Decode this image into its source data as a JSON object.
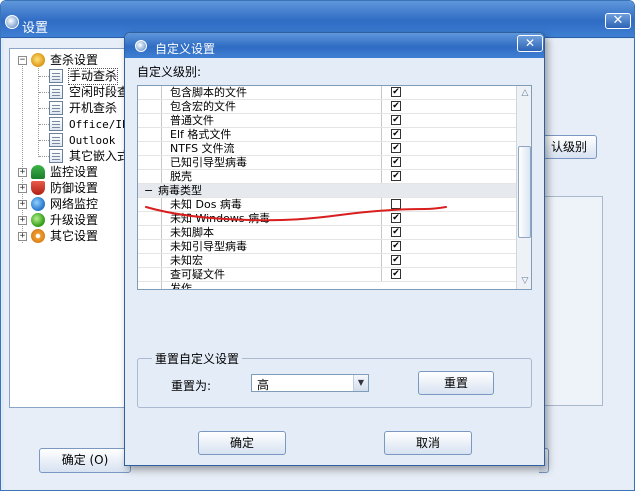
{
  "outer_window": {
    "title": "设置",
    "close_glyph": "✕",
    "tree": [
      {
        "label": "查杀设置",
        "expander": "−",
        "icon": "magnifier-shield-icon"
      },
      {
        "label": "手动查杀",
        "icon": "document-icon",
        "selected": true
      },
      {
        "label": "空闲时段查",
        "icon": "document-icon"
      },
      {
        "label": "开机查杀",
        "icon": "document-icon"
      },
      {
        "label": "Office/IE",
        "icon": "document-icon"
      },
      {
        "label": "Outlook",
        "icon": "document-icon"
      },
      {
        "label": "其它嵌入式",
        "icon": "document-icon"
      },
      {
        "label": "监控设置",
        "expander": "+",
        "icon": "umbrella-icon"
      },
      {
        "label": "防御设置",
        "expander": "+",
        "icon": "shield-icon"
      },
      {
        "label": "网络监控",
        "expander": "+",
        "icon": "globe-icon"
      },
      {
        "label": "升级设置",
        "expander": "+",
        "icon": "check-icon"
      },
      {
        "label": "其它设置",
        "expander": "+",
        "icon": "gear-icon"
      }
    ],
    "default_level_button": "认级别",
    "ok_button": "确定 (O)"
  },
  "dialog": {
    "title": "自定义设置",
    "close_glyph": "✕",
    "level_label": "自定义级别:",
    "rows": [
      {
        "label": "包含脚本的文件",
        "checked": true
      },
      {
        "label": "包含宏的文件",
        "checked": true
      },
      {
        "label": "普通文件",
        "checked": true
      },
      {
        "label": "Elf 格式文件",
        "checked": true
      },
      {
        "label": "NTFS 文件流",
        "checked": true
      },
      {
        "label": "已知引导型病毒",
        "checked": true
      },
      {
        "label": "脱壳",
        "checked": true
      },
      {
        "label": "病毒类型",
        "group": true,
        "expander": "−"
      },
      {
        "label": "未知 Dos 病毒",
        "checked": false
      },
      {
        "label": "未知 Windows 病毒",
        "checked": true
      },
      {
        "label": "未知脚本",
        "checked": true
      },
      {
        "label": "未知引导型病毒",
        "checked": true
      },
      {
        "label": "未知宏",
        "checked": true
      },
      {
        "label": "查可疑文件",
        "checked": true
      },
      {
        "label": "发作",
        "cutoff": true
      }
    ],
    "check_glyph": "✔",
    "scroll_up_glyph": "△",
    "scroll_down_glyph": "▽",
    "reset_group_title": "重置自定义设置",
    "reset_to_label": "重置为:",
    "reset_value": "高",
    "reset_button": "重置",
    "ok_button": "确定",
    "cancel_button": "取消"
  },
  "annotation": {
    "color": "#d81e1e"
  }
}
